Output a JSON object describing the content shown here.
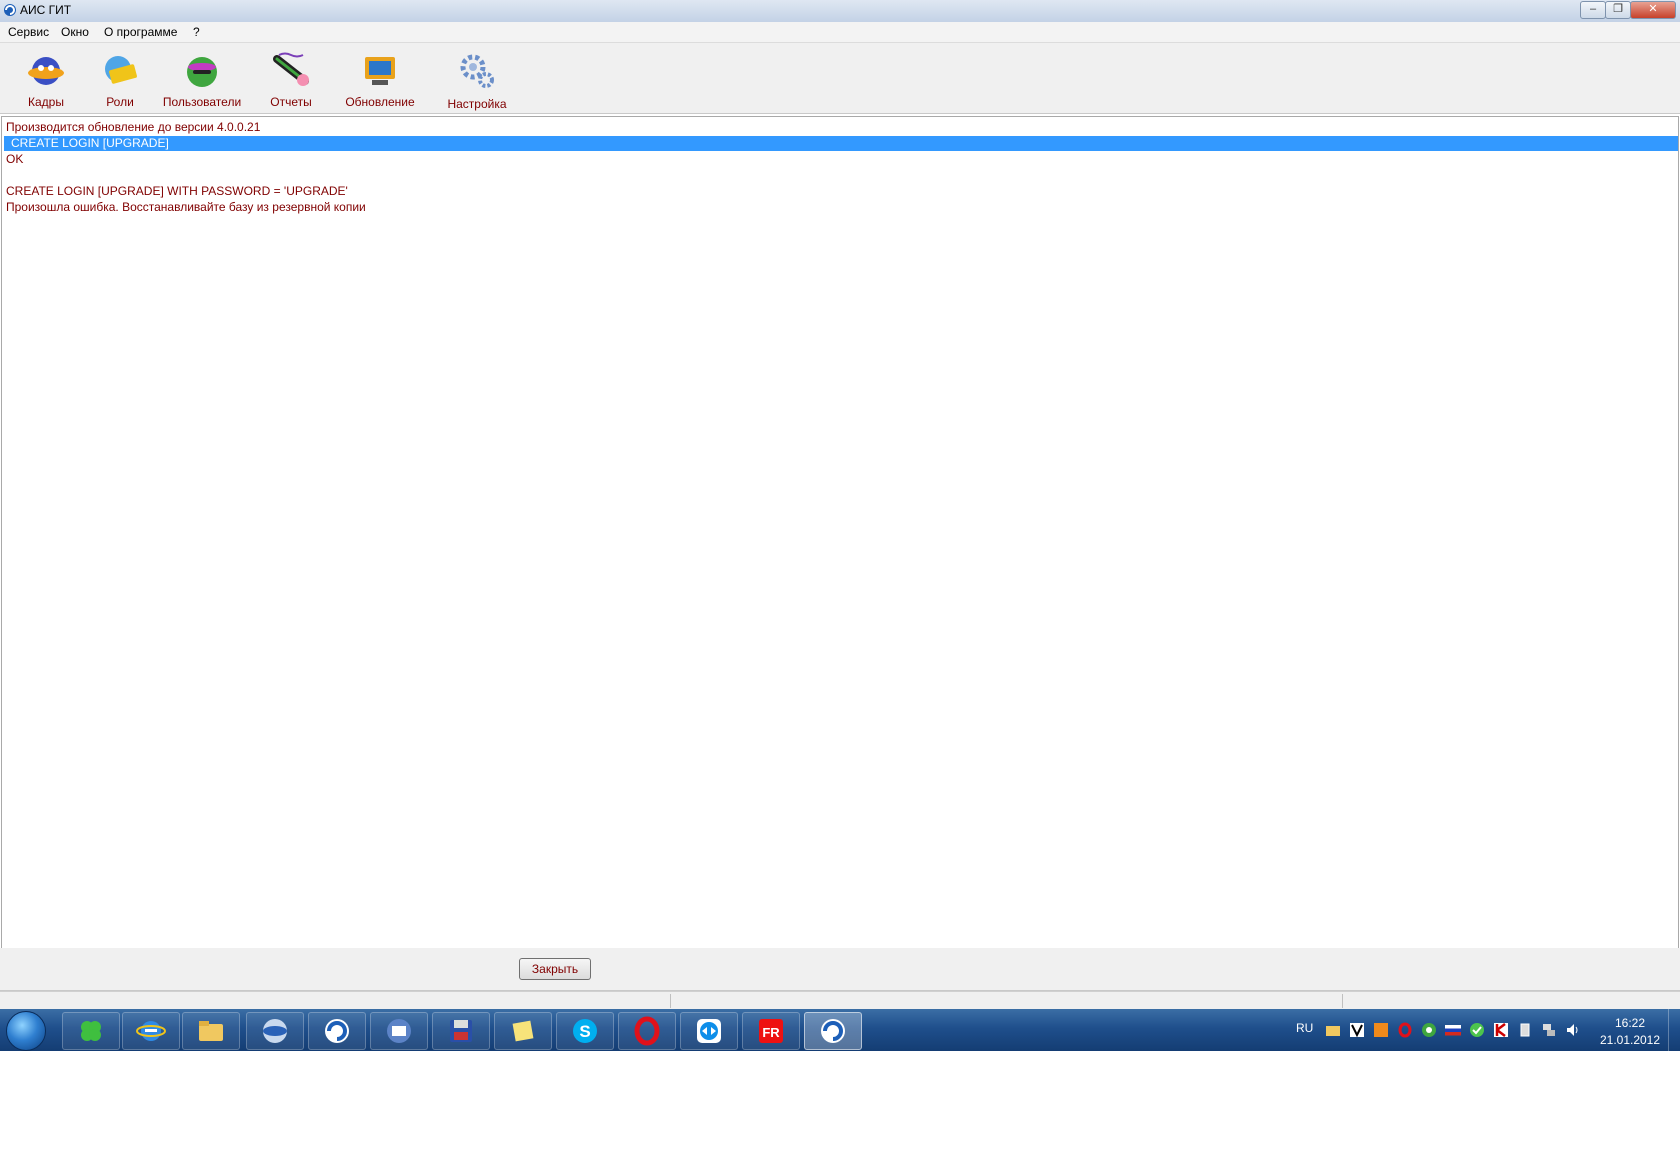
{
  "window": {
    "title": "АИС ГИТ",
    "minimize_glyph": "–",
    "restore_glyph": "❐",
    "close_glyph": "✕"
  },
  "menu": {
    "items": [
      "Сервис",
      "Окно",
      "О программе",
      "?"
    ]
  },
  "toolbar": {
    "buttons": [
      {
        "label": "Кадры",
        "icon": "staff-icon"
      },
      {
        "label": "Роли",
        "icon": "roles-icon"
      },
      {
        "label": "Пользователи",
        "icon": "users-icon"
      },
      {
        "label": "Отчеты",
        "icon": "reports-icon"
      },
      {
        "label": "Обновление",
        "icon": "update-icon"
      },
      {
        "label": "Настройка",
        "icon": "settings-gear-icon"
      }
    ]
  },
  "log": {
    "lines": [
      "Производится обновление до версии 4.0.0.21",
      "CREATE LOGIN [UPGRADE]",
      "OK",
      "",
      "CREATE LOGIN [UPGRADE] WITH PASSWORD = 'UPGRADE'",
      "Произошла ошибка. Восстанавливайте базу из резервной копии"
    ],
    "selected_index": 1
  },
  "actions": {
    "close_label": "Закрыть"
  },
  "taskbar": {
    "language": "RU",
    "time": "16:22",
    "date": "21.01.2012",
    "skype_glyph": "S",
    "opera_glyph": "O",
    "fr_glyph": "FR"
  },
  "colors": {
    "text": "#800000",
    "selection": "#3399ff",
    "taskbar": "#1f4f8c"
  }
}
